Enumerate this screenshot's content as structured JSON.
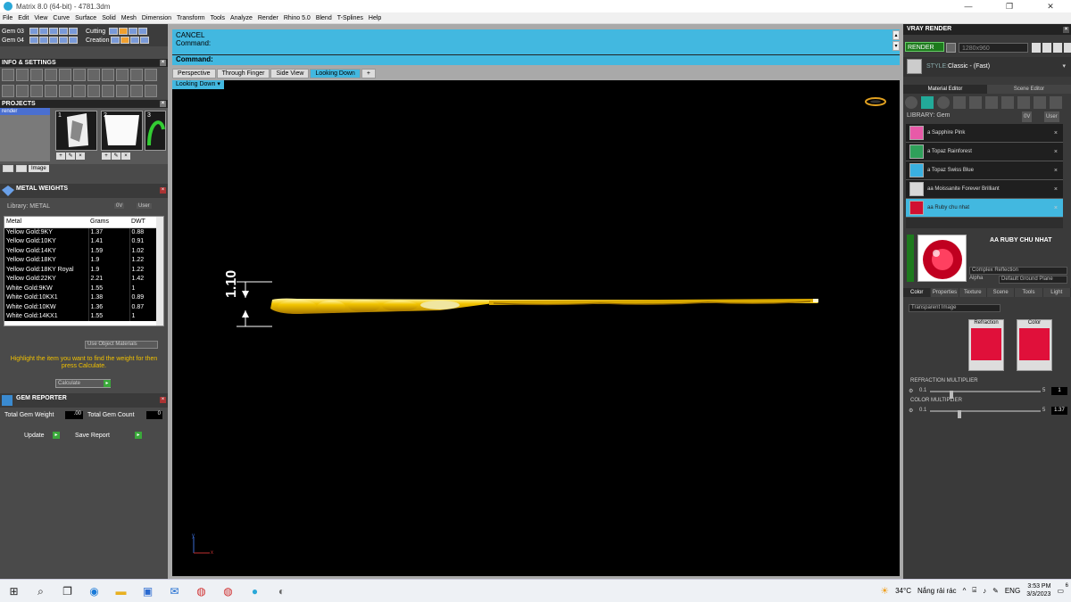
{
  "window": {
    "title": "Matrix 8.0 (64-bit) - 4781.3dm",
    "min": "—",
    "max": "❐",
    "close": "✕"
  },
  "menu": [
    "File",
    "Edit",
    "View",
    "Curve",
    "Surface",
    "Solid",
    "Mesh",
    "Dimension",
    "Transform",
    "Tools",
    "Analyze",
    "Render",
    "Rhino 5.0",
    "Blend",
    "T-Splines",
    "Help"
  ],
  "gembar": {
    "gem03": "Gem 03",
    "gem04": "Gem 04",
    "cutting": "Cutting",
    "creation": "Creation"
  },
  "info_settings": {
    "title": "INFO & SETTINGS"
  },
  "projects": {
    "title": "PROJECTS",
    "selected": "render",
    "thumbs": [
      "1",
      "2",
      "3"
    ],
    "image_btn": "Image"
  },
  "metal_weights": {
    "title": "METAL WEIGHTS",
    "library_label": "Library: METAL",
    "filter_0v": "0V",
    "filter_user": "User",
    "columns": [
      "Metal",
      "Grams",
      "DWT"
    ],
    "rows": [
      [
        "Yellow Gold:9KY",
        "1.37",
        "0.88"
      ],
      [
        "Yellow Gold:10KY",
        "1.41",
        "0.91"
      ],
      [
        "Yellow Gold:14KY",
        "1.59",
        "1.02"
      ],
      [
        "Yellow Gold:18KY",
        "1.9",
        "1.22"
      ],
      [
        "Yellow Gold:18KY Royal",
        "1.9",
        "1.22"
      ],
      [
        "Yellow Gold:22KY",
        "2.21",
        "1.42"
      ],
      [
        "White Gold:9KW",
        "1.55",
        "1"
      ],
      [
        "White Gold:10KX1",
        "1.38",
        "0.89"
      ],
      [
        "White Gold:10KW",
        "1.36",
        "0.87"
      ],
      [
        "White Gold:14KX1",
        "1.55",
        "1"
      ]
    ],
    "use_object_materials": "Use Object Materials",
    "hint": "Highlight the item you want to find the weight for then press Calculate.",
    "calculate": "Calculate"
  },
  "gem_reporter": {
    "title": "GEM REPORTER",
    "total_weight_label": "Total Gem Weight",
    "total_weight_value": ".00",
    "total_count_label": "Total Gem Count",
    "total_count_value": "0",
    "update": "Update",
    "save_report": "Save Report"
  },
  "command": {
    "line1": "CANCEL",
    "line2": "Command:",
    "prompt": "Command:"
  },
  "viewport_tabs": [
    "Perspective",
    "Through Finger",
    "Side View",
    "Looking Down"
  ],
  "active_tab": "Looking Down",
  "add_tab": "+",
  "viewport_label": "Looking Down",
  "dimension_text": "1.10",
  "axes": {
    "y": "y",
    "x": "x"
  },
  "vray": {
    "title": "VRAY RENDER",
    "render_btn": "RENDER",
    "resolution": "1280x960",
    "style_label": "STYLE:",
    "style_value": "Classic - (Fast)",
    "tabs": [
      "Material Editor",
      "Scene Editor"
    ],
    "library": "LIBRARY: Gem",
    "filter_0v": "0V",
    "filter_user": "User",
    "materials": [
      {
        "name": "a Sapphire Pink",
        "color": "#e85aa8"
      },
      {
        "name": "a Topaz Rainforest",
        "color": "#2fa05a"
      },
      {
        "name": "a Topaz Swiss Blue",
        "color": "#3ab0e0"
      },
      {
        "name": "aa Moissanite Forever Brilliant",
        "color": "#d8d8d8"
      },
      {
        "name": "aa Ruby chu nhat",
        "color": "#d01030"
      }
    ],
    "selected_material": "AA RUBY CHU NHAT",
    "complex_reflection": "Complex Reflection",
    "alpha": "Alpha",
    "ground_plane": "Default Ground Plane",
    "subtabs": [
      "Color",
      "Properties",
      "Texture",
      "Scene",
      "Tools",
      "Light"
    ],
    "transparent": "Transparent Image",
    "refraction": "Refraction",
    "color": "Color",
    "refraction_multiplier": {
      "label": "REFRACTION MULTIPLIER",
      "min": "0.1",
      "max": "5",
      "value": "1",
      "level": 0.18
    },
    "color_multiplier": {
      "label": "COLOR MULTIPLIER",
      "min": "0.1",
      "max": "5",
      "value": "1.37",
      "level": 0.25
    }
  },
  "taskbar": {
    "weather_temp": "34°C",
    "weather_text": "Nắng rải rác",
    "lang": "ENG",
    "time": "3:53 PM",
    "date": "3/3/2023",
    "notifications": "6"
  }
}
